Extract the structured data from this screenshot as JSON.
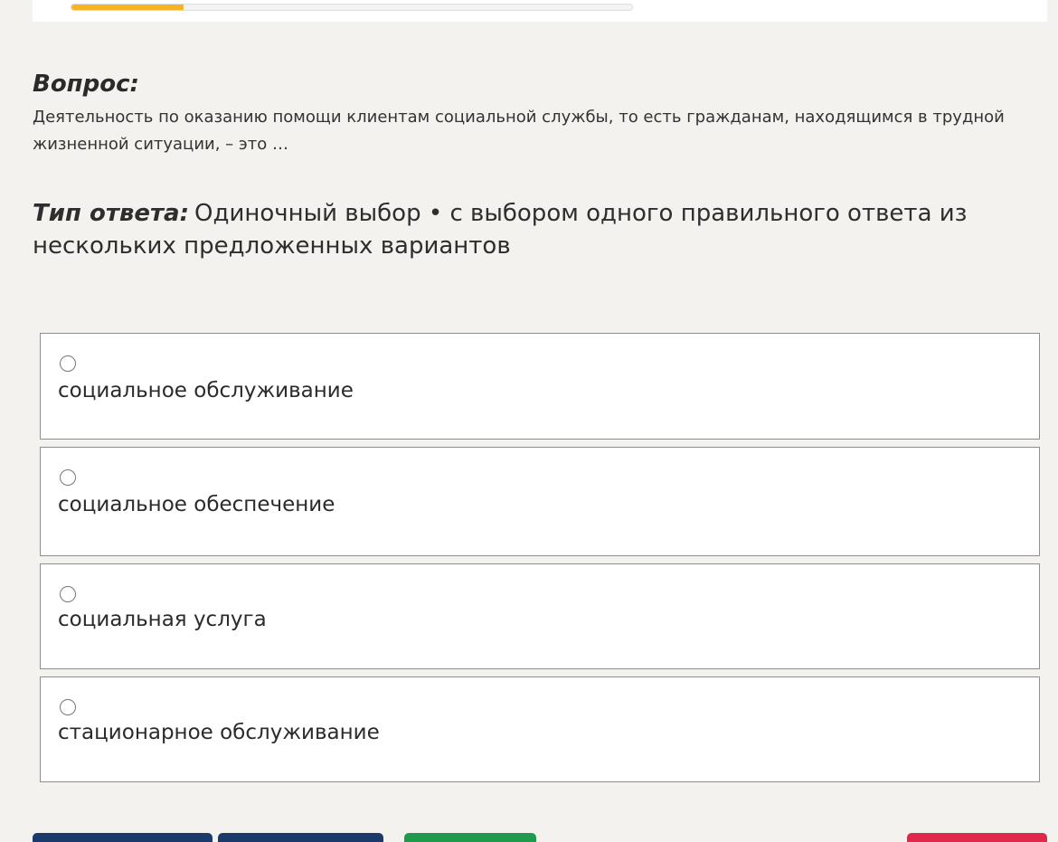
{
  "progress": {
    "fraction": 0.2,
    "color": "#f6b324"
  },
  "question": {
    "heading": "Вопрос:",
    "text": "Деятельность по оказанию помощи клиентам социальной службы, то есть гражданам, находящимся в трудной жизненной ситуации, – это …"
  },
  "answer_type": {
    "label": "Тип ответа:",
    "value": "Одиночный выбор • с выбором одного правильного ответа из нескольких предложенных вариантов"
  },
  "options": [
    {
      "label": "социальное обслуживание",
      "selected": false
    },
    {
      "label": "социальное обеспечение",
      "selected": false
    },
    {
      "label": "социальная услуга",
      "selected": false
    },
    {
      "label": "стационарное обслуживание",
      "selected": false
    }
  ],
  "buttons": {
    "colors": {
      "primary": "#1a3a6b",
      "success": "#1f9a4a",
      "danger": "#e0284b"
    }
  }
}
